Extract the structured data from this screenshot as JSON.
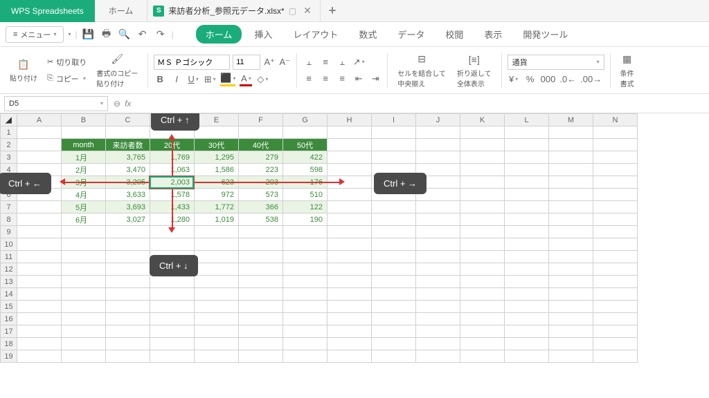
{
  "titlebar": {
    "app_name": "WPS Spreadsheets",
    "home_tab": "ホーム",
    "file_icon_letter": "S",
    "file_name": "来訪者分析_参照元データ.xlsx*",
    "close_x": "✕",
    "plus": "+"
  },
  "menubar": {
    "menu_label": "メニュー",
    "tabs": [
      "ホーム",
      "挿入",
      "レイアウト",
      "数式",
      "データ",
      "校閲",
      "表示",
      "開発ツール"
    ]
  },
  "toolbar": {
    "paste": "貼り付け",
    "cut": "切り取り",
    "copy": "コピー",
    "format_painter": "書式のコピー\n貼り付け",
    "font_name": "ＭＳ Ｐゴシック",
    "font_size": "11",
    "merge": "セルを結合して\n中央揃え",
    "wrap": "折り返して\n全体表示",
    "currency": "通貨",
    "conditional": "条件\n書式"
  },
  "namebox": {
    "cell": "D5",
    "fx": "fx"
  },
  "columns": [
    "A",
    "B",
    "C",
    "D",
    "E",
    "F",
    "G",
    "H",
    "I",
    "J",
    "K",
    "L",
    "M",
    "N"
  ],
  "rows": [
    1,
    2,
    3,
    4,
    5,
    6,
    7,
    8,
    9,
    10,
    11,
    12,
    13,
    14,
    15,
    16,
    17,
    18,
    19
  ],
  "chart_data": {
    "type": "table",
    "headers": [
      "month",
      "来訪者数",
      "20代",
      "30代",
      "40代",
      "50代"
    ],
    "rows": [
      [
        "1月",
        "3,765",
        "1,769",
        "1,295",
        "279",
        "422"
      ],
      [
        "2月",
        "3,470",
        "1,063",
        "1,586",
        "223",
        "598"
      ],
      [
        "3月",
        "3,205",
        "2,003",
        "623",
        "203",
        "176"
      ],
      [
        "4月",
        "3,633",
        "1,578",
        "972",
        "573",
        "510"
      ],
      [
        "5月",
        "3,693",
        "1,433",
        "1,772",
        "366",
        "122"
      ],
      [
        "6月",
        "3,027",
        "1,280",
        "1,019",
        "538",
        "190"
      ]
    ]
  },
  "badges": {
    "up": "Ctrl + ↑",
    "down": "Ctrl + ↓",
    "left": "Ctrl + ←",
    "right": "Ctrl + →"
  }
}
